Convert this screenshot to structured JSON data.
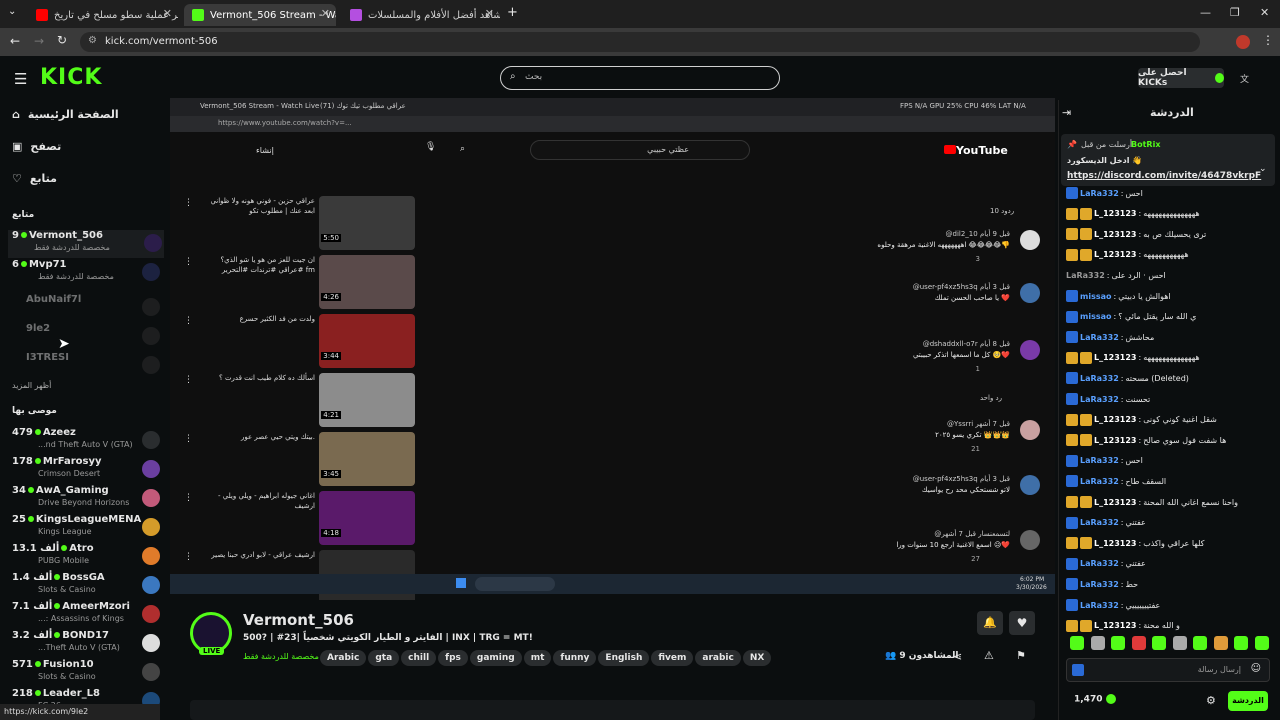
{
  "browser": {
    "tabs": [
      {
        "title": "اكبر عملية سطو مسلح في تاريخ",
        "active": false
      },
      {
        "title": "Vermont_506 Stream - Watch Live",
        "active": true
      },
      {
        "title": "شاهد أفضل الأفلام والمسلسلات",
        "active": false
      }
    ],
    "url": "kick.com/vermont-506",
    "status_url": "https://kick.com/9le2"
  },
  "header": {
    "logo": "KICK",
    "search_placeholder": "بحث",
    "get_kicks_label": "احصل على KICKs"
  },
  "sidebar": {
    "nav": [
      {
        "label": "الصفحة الرئيسية",
        "icon": "home-icon"
      },
      {
        "label": "تصفح",
        "icon": "browse-icon"
      },
      {
        "label": "متابع",
        "icon": "heart-icon"
      }
    ],
    "following_heading": "متابع",
    "following": [
      {
        "viewers": "9",
        "name": "Vermont_506",
        "sub": "مخصصة للدردشة فقط",
        "live": true
      },
      {
        "viewers": "6",
        "name": "Mvp71",
        "sub": "مخصصة للدردشة فقط",
        "live": true
      },
      {
        "viewers": "",
        "name": "AbuNaif7l",
        "sub": "",
        "live": false
      },
      {
        "viewers": "",
        "name": "9le2",
        "sub": "",
        "live": false
      },
      {
        "viewers": "",
        "name": "I3TRESI",
        "sub": "",
        "live": false
      }
    ],
    "show_more": "أظهر المزيد",
    "recommended_heading": "موصى بها",
    "recommended": [
      {
        "viewers": "479",
        "name": "Azeez",
        "sub": "...nd Theft Auto V (GTA)"
      },
      {
        "viewers": "178",
        "name": "MrFarosyy",
        "sub": "Crimson Desert"
      },
      {
        "viewers": "34",
        "name": "AwA_Gaming",
        "sub": "Drive Beyond Horizons"
      },
      {
        "viewers": "25",
        "name": "KingsLeagueMENA",
        "sub": "Kings League"
      },
      {
        "viewers": "13.1 ألف",
        "name": "Atro",
        "sub": "PUBG Mobile"
      },
      {
        "viewers": "1.4 ألف",
        "name": "BossGA",
        "sub": "Slots & Casino"
      },
      {
        "viewers": "7.1 ألف",
        "name": "AmeerMzori",
        "sub": "...: Assassins of Kings"
      },
      {
        "viewers": "3.2 ألف",
        "name": "BOND17",
        "sub": "...Theft Auto V (GTA)"
      },
      {
        "viewers": "571",
        "name": "Fusion10",
        "sub": "Slots & Casino"
      },
      {
        "viewers": "218",
        "name": "Leader_L8",
        "sub": "FC 26"
      }
    ]
  },
  "video": {
    "inner_tabs": [
      "Vermont_506 Stream - Watch Live",
      "عراقي مطلوب تيك توك (71)"
    ],
    "inner_url": "https://www.youtube.com/watch?v=...",
    "stats": "FPS N/A  GPU 25%  CPU 46%  LAT N/A",
    "yt_search": "عظتي حبيبي",
    "create_label": "إنشاء",
    "yt_logo": "YouTube",
    "reply_count_label": "10 ردود",
    "one_reply_label": "رد واحد",
    "videos": [
      {
        "title": "عراقي حزين - فوني هونه ولا ظواني ابعد عنك | مطلوب تكو",
        "duration": "5:50"
      },
      {
        "title": "ان جيت للعز من هو يا شو الذي؟ #عراقي #ترندات #التحرير fm",
        "duration": "4:26"
      },
      {
        "title": "ولدت من فد الكثير حسرع",
        "duration": "3:44"
      },
      {
        "title": "اسألك ده كلام طيب انت قدرت ؟",
        "duration": "4:21"
      },
      {
        "title": "بيتك ويتي حيي عصر عور.",
        "duration": "3:45"
      },
      {
        "title": "اغاني جيوله ابراهيم - ويلي ويلي - ارشيف",
        "duration": "4:18"
      },
      {
        "title": "ارشيف عراقي - لابو ادري حبنا يصير",
        "duration": ""
      }
    ],
    "comments": [
      {
        "author": "@dil2_10 قبل 9 أيام",
        "text": "اهههههههه الاغنية مرهقة وحلوه 😂😂😂😂👎",
        "likes": "3"
      },
      {
        "author": "@user-pf4xz5hs3q قبل 3 أيام",
        "text": "يا صاحب الحسن تملك ❤️",
        "likes": ""
      },
      {
        "author": "@dshaddxll-o7r قبل 8 أيام",
        "text": "كل ما اسمعها اتذكر حبيبتي 🥺❤️",
        "likes": "1"
      },
      {
        "author": "@Yssrri قبل 7 أشهر",
        "text": "تكري يسو ٢٠٢٥ 👑👑👑",
        "likes": "21"
      },
      {
        "author": "@user-pf4xz5hs3q قبل 3 أيام",
        "text": "لاتو شستحكي محد رح يواسيك",
        "likes": ""
      },
      {
        "author": "@لتسمعنسار قبل 7 أشهر",
        "text": "اسمع الاغنية ارجع 10 سنوات ورا 😥❤️",
        "likes": "27"
      }
    ],
    "clock_time": "6:02 PM",
    "clock_date": "3/30/2026"
  },
  "stream": {
    "name": "Vermont_506",
    "title": "الفايتر و الطيار الكويتي شخصياً |23# | ?500 | INX | TRG = MT!",
    "live_label": "LIVE",
    "chat_mode": "مخصصة للدردشة فقط",
    "tags": [
      "Arabic",
      "gta",
      "chill",
      "fps",
      "gaming",
      "mt",
      "funny",
      "English",
      "fivem",
      "arabic",
      "NX"
    ],
    "viewers_label": "المشاهدون 9"
  },
  "chat": {
    "title": "الدردشة",
    "pinned_by": "أرسلت من قبل",
    "pinned_user": "BotRix",
    "pinned_text": "ادخل الديسكورد 👋",
    "pinned_link": "https://discord.com/invite/46478vkrpF",
    "messages": [
      {
        "user": "LaRa332",
        "text": "احس",
        "badge": "k",
        "color": "#5aa0ff"
      },
      {
        "user": "L_123123",
        "text": "ههههههههههههههه",
        "badge": "y",
        "color": "#ffffff"
      },
      {
        "user": "L_123123",
        "text": "تری يحسيلك ص به",
        "badge": "y",
        "color": "#ffffff"
      },
      {
        "user": "L_123123",
        "text": "هههههههههههه",
        "badge": "y",
        "color": "#ffffff"
      },
      {
        "user": "LaRa332",
        "text": "احس · الرد على",
        "badge": "",
        "color": "#999999"
      },
      {
        "user": "missao",
        "text": "اهوالش يا دبيتي",
        "badge": "k",
        "color": "#5aa0ff"
      },
      {
        "user": "missao",
        "text": "ي الله سار يقتل مائي ؟",
        "badge": "k",
        "color": "#5aa0ff"
      },
      {
        "user": "LaRa332",
        "text": "محاشش",
        "badge": "k",
        "color": "#5aa0ff"
      },
      {
        "user": "L_123123",
        "text": "ههههههههههههههه",
        "badge": "y",
        "color": "#ffffff"
      },
      {
        "user": "LaRa332",
        "text": "مسحته (Deleted)",
        "badge": "k",
        "color": "#5aa0ff"
      },
      {
        "user": "LaRa332",
        "text": "تحسنت",
        "badge": "k",
        "color": "#5aa0ff"
      },
      {
        "user": "L_123123",
        "text": "شقل اغنية كوني كونى",
        "badge": "y",
        "color": "#ffffff"
      },
      {
        "user": "L_123123",
        "text": "ها شفت فول سوي صالح",
        "badge": "y",
        "color": "#ffffff"
      },
      {
        "user": "LaRa332",
        "text": "احس",
        "badge": "k",
        "color": "#5aa0ff"
      },
      {
        "user": "LaRa332",
        "text": "السقف طاح",
        "badge": "k",
        "color": "#5aa0ff"
      },
      {
        "user": "L_123123",
        "text": "واحنا نسمع اغاني الله المحنة",
        "badge": "y",
        "color": "#ffffff"
      },
      {
        "user": "LaRa332",
        "text": "عفتني",
        "badge": "k",
        "color": "#5aa0ff"
      },
      {
        "user": "L_123123",
        "text": "كلها عراقي واكذب",
        "badge": "y",
        "color": "#ffffff"
      },
      {
        "user": "LaRa332",
        "text": "عفتني",
        "badge": "k",
        "color": "#5aa0ff"
      },
      {
        "user": "LaRa332",
        "text": "حط",
        "badge": "k",
        "color": "#5aa0ff"
      },
      {
        "user": "LaRa332",
        "text": "عفتيييييييي",
        "badge": "k",
        "color": "#5aa0ff"
      },
      {
        "user": "L_123123",
        "text": "و الله محنة",
        "badge": "y",
        "color": "#ffffff"
      }
    ],
    "input_placeholder": "إرسال رسالة",
    "kicks_count": "1,470",
    "send_label": "الدردشة"
  },
  "colors": {
    "accent": "#53fc18",
    "bg": "#0b0e0f"
  }
}
